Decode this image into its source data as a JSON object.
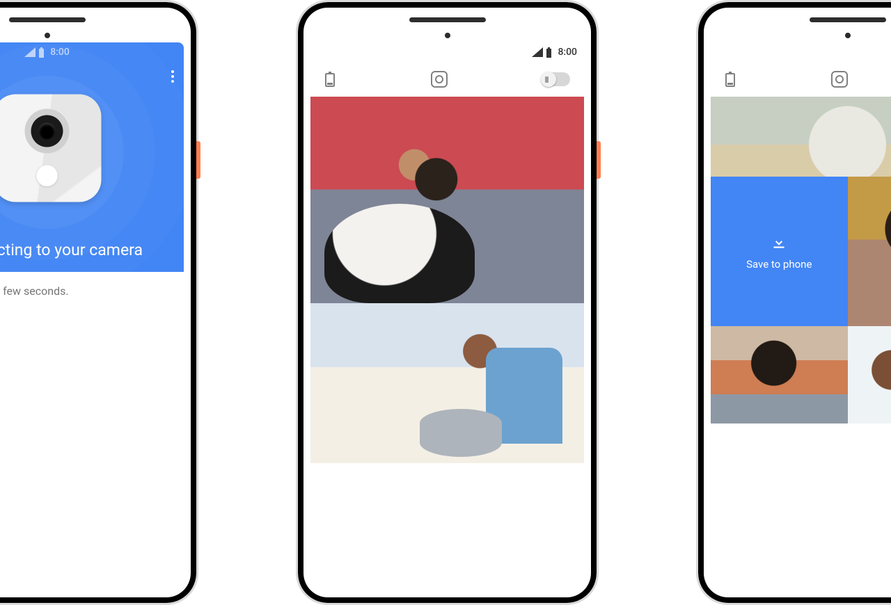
{
  "status": {
    "time": "8:00"
  },
  "phone1": {
    "headline": "Connecting to your camera",
    "sub": "This will take a few seconds."
  },
  "phone3": {
    "save_label": "Save to phone"
  },
  "icons": {
    "battery_low": "battery-low-icon",
    "camera_nav": "camera-nav-icon",
    "toggle": "view-toggle",
    "download": "download-icon",
    "signal": "signal-icon",
    "battery": "battery-icon",
    "kebab": "more-icon"
  }
}
